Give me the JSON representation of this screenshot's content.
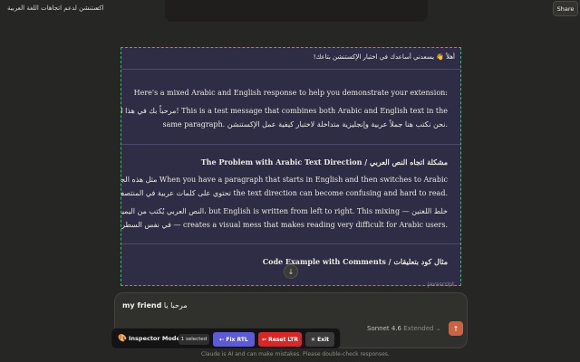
{
  "header": {
    "conversation_title": "اكستنشن لدعم اتجاهات اللغة العربية",
    "share_label": "Share"
  },
  "message": {
    "greeting": "أهلاً 👋 يسعدني أساعدك في اختبار الإكستنشن بتاعك!",
    "intro": "Here's a mixed Arabic and English response to help you demonstrate your extension:",
    "para1_line1": "مرحباً بك في هذا الاختبار! This is a test message that combines both Arabic and English text in the",
    "para1_line2": "same paragraph. نحن نكتب هنا جملاً عربية وإنجليزية متداخلة لاختبار كيفية عمل الإكستنشن.",
    "heading1": "The Problem with Arabic Text Direction / مشكلة اتجاه النص العربي",
    "para2_line1": "مثل هذه الجملة التي When you have a paragraph that starts in English and then switches to Arabic",
    "para2_line2": "تحتوي على كلمات عربية في المنتصف the text direction can become confusing and hard to read.",
    "para3_line1": "النص العربي يُكتب من اليمين إلى اليسار، but English is written from left to right. This mixing — خلط اللغتين",
    "para3_line2": "في نفس السطر — creates a visual mess that makes reading very difficult for Arabic users.",
    "heading2": "Code Example with Comments / مثال كود بتعليقات",
    "code_lang": "javascript"
  },
  "composer": {
    "input_bold": "my friend",
    "input_arabic": "مرحبا يا",
    "model_name": "Sonnet 4.6",
    "model_mode": "Extended"
  },
  "inspector": {
    "title": "Inspector Mode",
    "selected": "1 selected",
    "fix_rtl": "Fix RTL",
    "reset_ltr": "Reset LTR",
    "exit": "Exit"
  },
  "footer": {
    "disclaimer": "Claude is AI and can make mistakes. Please double-check responses."
  },
  "colors": {
    "background": "#262624",
    "message_bg": "#2f2d46",
    "selection_outline": "#22c55e",
    "send_button": "#c96442",
    "fix_rtl": "#5b5bd6",
    "reset_ltr": "#d62828"
  }
}
